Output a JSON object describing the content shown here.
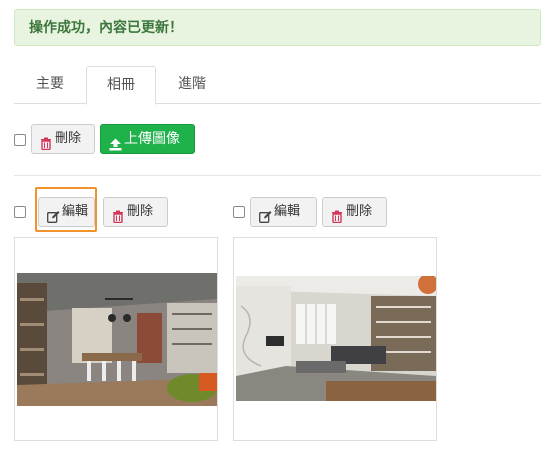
{
  "alert": {
    "message": "操作成功，內容已更新！"
  },
  "tabs": [
    {
      "label": "主要",
      "active": false
    },
    {
      "label": "相冊",
      "active": true
    },
    {
      "label": "進階",
      "active": false
    }
  ],
  "toolbar": {
    "delete_label": "刪除",
    "upload_label": "上傳圖像"
  },
  "photos": [
    {
      "edit_label": "編輯",
      "delete_label": "刪除",
      "checked": false
    },
    {
      "edit_label": "編輯",
      "delete_label": "刪除",
      "checked": false
    }
  ],
  "colors": {
    "success_bg": "#e8f4e0",
    "success_text": "#3c763d",
    "upload_green": "#1fb24b",
    "highlight": "#f0932b"
  },
  "icons": {
    "delete": "trash-icon",
    "upload": "upload-icon",
    "edit": "edit-icon"
  }
}
